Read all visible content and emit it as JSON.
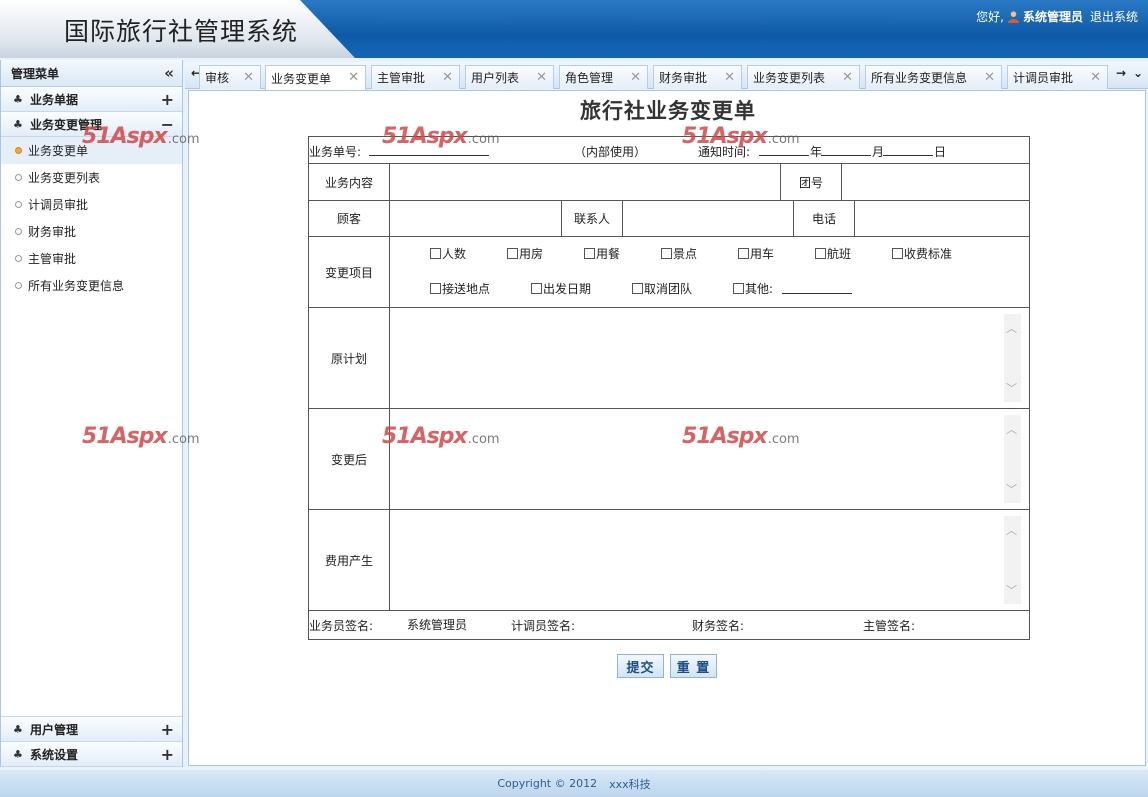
{
  "header": {
    "title": "国际旅行社管理系统",
    "greeting": "您好,",
    "user_name": "系统管理员",
    "logout": "退出系统"
  },
  "sidebar": {
    "title": "管理菜单",
    "groups": [
      {
        "label": "业务单据",
        "toggle": "+"
      },
      {
        "label": "业务变更管理",
        "toggle": "−"
      }
    ],
    "items": [
      {
        "label": "业务变更单"
      },
      {
        "label": "业务变更列表"
      },
      {
        "label": "计调员审批"
      },
      {
        "label": "财务审批"
      },
      {
        "label": "主管审批"
      },
      {
        "label": "所有业务变更信息"
      }
    ],
    "bottom_groups": [
      {
        "label": "用户管理",
        "toggle": "+"
      },
      {
        "label": "系统设置",
        "toggle": "+"
      }
    ]
  },
  "tabs": [
    {
      "label": "审核"
    },
    {
      "label": "业务变更单"
    },
    {
      "label": "主管审批"
    },
    {
      "label": "用户列表"
    },
    {
      "label": "角色管理"
    },
    {
      "label": "财务审批"
    },
    {
      "label": "业务变更列表"
    },
    {
      "label": "所有业务变更信息"
    },
    {
      "label": "计调员审批"
    }
  ],
  "form": {
    "title": "旅行社业务变更单",
    "order_no_label": "业务单号:",
    "internal_use": "（内部使用）",
    "notice_time_label": "通知时间:",
    "year": "年",
    "month": "月",
    "day": "日",
    "business_content": "业务内容",
    "group_no": "团号",
    "customer": "顾客",
    "contact": "联系人",
    "phone": "电话",
    "change_items_label": "变更项目",
    "change_items_row1": [
      "人数",
      "用房",
      "用餐",
      "景点",
      "用车",
      "航班",
      "收费标准"
    ],
    "change_items_row2": [
      "接送地点",
      "出发日期",
      "取消团队",
      "其他:"
    ],
    "original_plan": "原计划",
    "after_change": "变更后",
    "cost_incurred": "费用产生",
    "salesman_sign": "业务员签名:",
    "salesman_value": "系统管理员",
    "planner_sign": "计调员签名:",
    "finance_sign": "财务签名:",
    "manager_sign": "主管签名:",
    "submit": "提交",
    "reset": "重 置"
  },
  "footer": {
    "copyright": "Copyright © 2012",
    "company": "xxx科技"
  },
  "watermark": {
    "brand": "51Aspx",
    "suffix": ".com"
  }
}
